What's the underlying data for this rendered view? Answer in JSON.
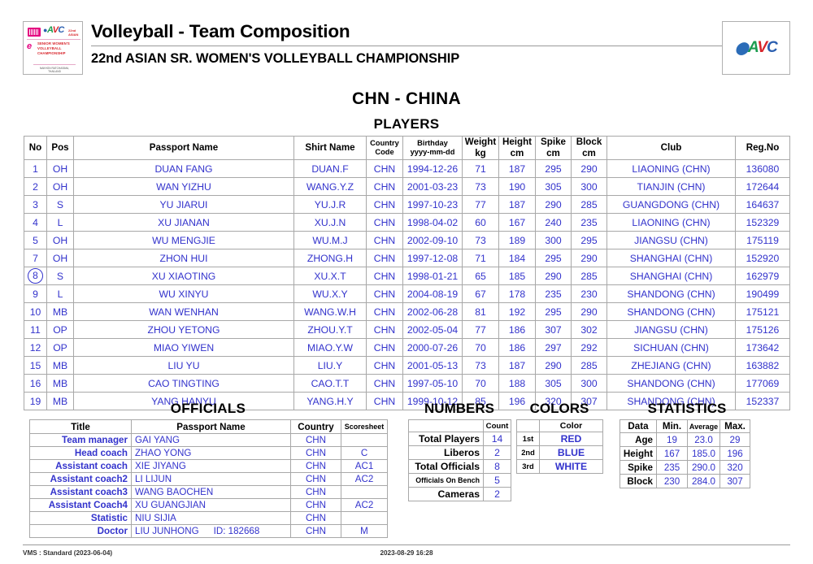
{
  "header": {
    "title": "Volleyball - Team Composition",
    "subtitle": "22nd ASIAN SR. WOMEN'S VOLLEYBALL CHAMPIONSHIP",
    "left_logo": {
      "event_name": "SENIOR WOMEN'S VOLLEYBALL CHAMPIONSHIP",
      "year_tag": "22nd ASIAN",
      "host": "NAKHON RATCHASIMA, THAILAND",
      "avc_letters": [
        "A",
        "V",
        "C"
      ]
    },
    "right_logo": {
      "avc_letters": [
        "A",
        "V",
        "C"
      ]
    }
  },
  "team": {
    "heading": "CHN - CHINA",
    "players_heading": "PLAYERS"
  },
  "players_table": {
    "columns": [
      {
        "label": "No",
        "small": false
      },
      {
        "label": "Pos",
        "small": false
      },
      {
        "label": "Passport Name",
        "small": false
      },
      {
        "label": "Shirt Name",
        "small": false
      },
      {
        "label": "Country\nCode",
        "line1": "Country",
        "line2": "Code",
        "small": true
      },
      {
        "label": "Birthday\nyyyy-mm-dd",
        "line1": "Birthday",
        "line2": "yyyy-mm-dd",
        "small": true
      },
      {
        "label": "Weight\nkg",
        "line1": "Weight",
        "line2": "kg",
        "small": false
      },
      {
        "label": "Height\ncm",
        "line1": "Height",
        "line2": "cm",
        "small": false
      },
      {
        "label": "Spike\ncm",
        "line1": "Spike",
        "line2": "cm",
        "small": false
      },
      {
        "label": "Block\ncm",
        "line1": "Block",
        "line2": "cm",
        "small": false
      },
      {
        "label": "Club",
        "small": false
      },
      {
        "label": "Reg.No",
        "small": false
      }
    ],
    "rows": [
      {
        "no": "1",
        "captain": false,
        "pos": "OH",
        "passport_name": "DUAN FANG",
        "shirt_name": "DUAN.F",
        "country_code": "CHN",
        "birthday": "1994-12-26",
        "weight": "71",
        "height": "187",
        "spike": "295",
        "block": "290",
        "club": "LIAONING (CHN)",
        "reg_no": "136080"
      },
      {
        "no": "2",
        "captain": false,
        "pos": "OH",
        "passport_name": "WAN YIZHU",
        "shirt_name": "WANG.Y.Z",
        "country_code": "CHN",
        "birthday": "2001-03-23",
        "weight": "73",
        "height": "190",
        "spike": "305",
        "block": "300",
        "club": "TIANJIN (CHN)",
        "reg_no": "172644"
      },
      {
        "no": "3",
        "captain": false,
        "pos": "S",
        "passport_name": "YU JIARUI",
        "shirt_name": "YU.J.R",
        "country_code": "CHN",
        "birthday": "1997-10-23",
        "weight": "77",
        "height": "187",
        "spike": "290",
        "block": "285",
        "club": "GUANGDONG (CHN)",
        "reg_no": "164637"
      },
      {
        "no": "4",
        "captain": false,
        "pos": "L",
        "passport_name": "XU JIANAN",
        "shirt_name": "XU.J.N",
        "country_code": "CHN",
        "birthday": "1998-04-02",
        "weight": "60",
        "height": "167",
        "spike": "240",
        "block": "235",
        "club": "LIAONING (CHN)",
        "reg_no": "152329"
      },
      {
        "no": "5",
        "captain": false,
        "pos": "OH",
        "passport_name": "WU MENGJIE",
        "shirt_name": "WU.M.J",
        "country_code": "CHN",
        "birthday": "2002-09-10",
        "weight": "73",
        "height": "189",
        "spike": "300",
        "block": "295",
        "club": "JIANGSU (CHN)",
        "reg_no": "175119"
      },
      {
        "no": "7",
        "captain": false,
        "pos": "OH",
        "passport_name": "ZHON HUI",
        "shirt_name": "ZHONG.H",
        "country_code": "CHN",
        "birthday": "1997-12-08",
        "weight": "71",
        "height": "184",
        "spike": "295",
        "block": "290",
        "club": "SHANGHAI (CHN)",
        "reg_no": "152920"
      },
      {
        "no": "8",
        "captain": true,
        "pos": "S",
        "passport_name": "XU XIAOTING",
        "shirt_name": "XU.X.T",
        "country_code": "CHN",
        "birthday": "1998-01-21",
        "weight": "65",
        "height": "185",
        "spike": "290",
        "block": "285",
        "club": "SHANGHAI (CHN)",
        "reg_no": "162979"
      },
      {
        "no": "9",
        "captain": false,
        "pos": "L",
        "passport_name": "WU XINYU",
        "shirt_name": "WU.X.Y",
        "country_code": "CHN",
        "birthday": "2004-08-19",
        "weight": "67",
        "height": "178",
        "spike": "235",
        "block": "230",
        "club": "SHANDONG (CHN)",
        "reg_no": "190499"
      },
      {
        "no": "10",
        "captain": false,
        "pos": "MB",
        "passport_name": "WAN WENHAN",
        "shirt_name": "WANG.W.H",
        "country_code": "CHN",
        "birthday": "2002-06-28",
        "weight": "81",
        "height": "192",
        "spike": "295",
        "block": "290",
        "club": "SHANDONG (CHN)",
        "reg_no": "175121"
      },
      {
        "no": "11",
        "captain": false,
        "pos": "OP",
        "passport_name": "ZHOU YETONG",
        "shirt_name": "ZHOU.Y.T",
        "country_code": "CHN",
        "birthday": "2002-05-04",
        "weight": "77",
        "height": "186",
        "spike": "307",
        "block": "302",
        "club": "JIANGSU (CHN)",
        "reg_no": "175126"
      },
      {
        "no": "12",
        "captain": false,
        "pos": "OP",
        "passport_name": "MIAO YIWEN",
        "shirt_name": "MIAO.Y.W",
        "country_code": "CHN",
        "birthday": "2000-07-26",
        "weight": "70",
        "height": "186",
        "spike": "297",
        "block": "292",
        "club": "SICHUAN (CHN)",
        "reg_no": "173642"
      },
      {
        "no": "15",
        "captain": false,
        "pos": "MB",
        "passport_name": "LIU YU",
        "shirt_name": "LIU.Y",
        "country_code": "CHN",
        "birthday": "2001-05-13",
        "weight": "73",
        "height": "187",
        "spike": "290",
        "block": "285",
        "club": "ZHEJIANG (CHN)",
        "reg_no": "163882"
      },
      {
        "no": "16",
        "captain": false,
        "pos": "MB",
        "passport_name": "CAO TINGTING",
        "shirt_name": "CAO.T.T",
        "country_code": "CHN",
        "birthday": "1997-05-10",
        "weight": "70",
        "height": "188",
        "spike": "305",
        "block": "300",
        "club": "SHANDONG (CHN)",
        "reg_no": "177069"
      },
      {
        "no": "19",
        "captain": false,
        "pos": "MB",
        "passport_name": "YANG HANYU",
        "shirt_name": "YANG.H.Y",
        "country_code": "CHN",
        "birthday": "1999-10-12",
        "weight": "85",
        "height": "196",
        "spike": "320",
        "block": "307",
        "club": "SHANDONG (CHN)",
        "reg_no": "152337"
      }
    ]
  },
  "officials": {
    "heading": "OFFICIALS",
    "columns": [
      "Title",
      "Passport Name",
      "Country",
      "Scoresheet"
    ],
    "rows": [
      {
        "title": "Team manager",
        "name": "GAI YANG",
        "id": "",
        "country": "CHN",
        "scoresheet": ""
      },
      {
        "title": "Head coach",
        "name": "ZHAO YONG",
        "id": "",
        "country": "CHN",
        "scoresheet": "C"
      },
      {
        "title": "Assistant coach",
        "name": "XIE JIYANG",
        "id": "",
        "country": "CHN",
        "scoresheet": "AC1"
      },
      {
        "title": "Assistant coach2",
        "name": "LI LIJUN",
        "id": "",
        "country": "CHN",
        "scoresheet": "AC2"
      },
      {
        "title": "Assistant coach3",
        "name": "WANG BAOCHEN",
        "id": "",
        "country": "CHN",
        "scoresheet": ""
      },
      {
        "title": "Assistant Coach4",
        "name": "XU GUANGJIAN",
        "id": "",
        "country": "CHN",
        "scoresheet": "AC2"
      },
      {
        "title": "Statistic",
        "name": "NIU SIJIA",
        "id": "",
        "country": "CHN",
        "scoresheet": ""
      },
      {
        "title": "Doctor",
        "name": "LIU JUNHONG",
        "id": "ID: 182668",
        "country": "CHN",
        "scoresheet": "M"
      }
    ]
  },
  "numbers": {
    "heading": "NUMBERS",
    "count_header": "Count",
    "rows": [
      {
        "label": "Total Players",
        "value": "14",
        "small": false
      },
      {
        "label": "Liberos",
        "value": "2",
        "small": false
      },
      {
        "label": "Total Officials",
        "value": "8",
        "small": false
      },
      {
        "label": "Officials On Bench",
        "value": "5",
        "small": true
      },
      {
        "label": "Cameras",
        "value": "2",
        "small": false
      }
    ]
  },
  "colors": {
    "heading": "COLORS",
    "color_header": "Color",
    "rows": [
      {
        "rank": "1st",
        "color": "RED"
      },
      {
        "rank": "2nd",
        "color": "BLUE"
      },
      {
        "rank": "3rd",
        "color": "WHITE"
      }
    ]
  },
  "statistics": {
    "heading": "STATISTICS",
    "columns": [
      "Data",
      "Min.",
      "Average",
      "Max."
    ],
    "rows": [
      {
        "data": "Age",
        "min": "19",
        "average": "23.0",
        "max": "29"
      },
      {
        "data": "Height",
        "min": "167",
        "average": "185.0",
        "max": "196"
      },
      {
        "data": "Spike",
        "min": "235",
        "average": "290.0",
        "max": "320"
      },
      {
        "data": "Block",
        "min": "230",
        "average": "284.0",
        "max": "307"
      }
    ]
  },
  "footer": {
    "left": "VMS : Standard (2023-06-04)",
    "timestamp": "2023-08-29 16:28"
  },
  "theme": {
    "value_blue": "#3333CC",
    "border_gray": "#A8A8A8",
    "logo_green": "#1A9C4E",
    "logo_red": "#D8262C",
    "logo_blue": "#2B5FB0",
    "accent_pink": "#E4007F"
  }
}
